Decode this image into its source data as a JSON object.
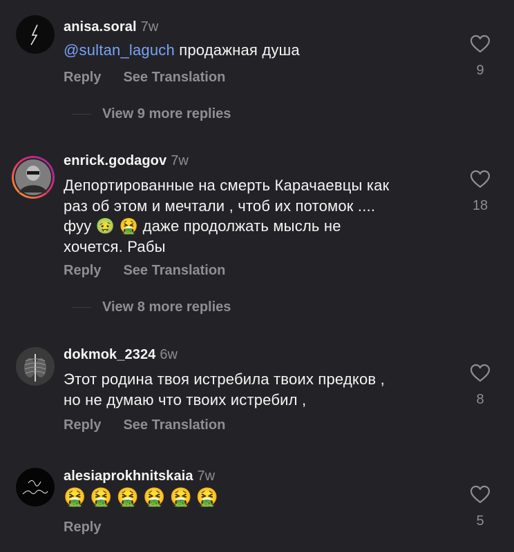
{
  "comments": [
    {
      "username": "anisa.soral",
      "time": "7w",
      "mention": "@sultan_laguch",
      "text": "продажная душа",
      "reply_label": "Reply",
      "translate_label": "See Translation",
      "likes": "9",
      "view_more": "View 9 more replies",
      "avatar_icon": "lightning-logo-avatar"
    },
    {
      "username": "enrick.godagov",
      "time": "7w",
      "text_lines": [
        "Депортированные  на смерть Карачаевцы как",
        "раз об этом и мечтали , чтоб их потомок ....",
        "фуу 🤢 🤮 даже продолжать мысль не",
        "хочется. Рабы"
      ],
      "reply_label": "Reply",
      "translate_label": "See Translation",
      "likes": "18",
      "view_more": "View 8 more replies",
      "avatar_icon": "masked-person-avatar",
      "avatar_ring": "#e1306c"
    },
    {
      "username": "dokmok_2324",
      "time": "6w",
      "text_lines": [
        "Этот родина твоя истребила твоих предков ,",
        "но не думаю что твоих истребил ,"
      ],
      "reply_label": "Reply",
      "translate_label": "See Translation",
      "likes": "8",
      "avatar_icon": "xray-avatar"
    },
    {
      "username": "alesiaprokhnitskaia",
      "time": "7w",
      "emoji_text": "🤮🤮🤮🤮🤮🤮",
      "reply_label": "Reply",
      "likes": "5",
      "avatar_icon": "signature-logo-avatar"
    }
  ],
  "colors": {
    "background": "#232327",
    "text": "#f5f5f5",
    "muted": "#8e8e93",
    "mention": "#7aa2f7"
  }
}
